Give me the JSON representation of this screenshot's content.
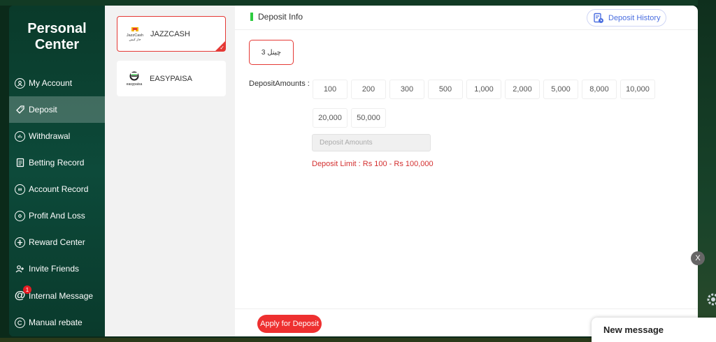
{
  "sidebar": {
    "title_line1": "Personal",
    "title_line2": "Center",
    "items": [
      {
        "label": "My Account"
      },
      {
        "label": "Deposit"
      },
      {
        "label": "Withdrawal"
      },
      {
        "label": "Betting Record"
      },
      {
        "label": "Account Record"
      },
      {
        "label": "Profit And Loss"
      },
      {
        "label": "Reward Center"
      },
      {
        "label": "Invite Friends"
      },
      {
        "label": "Internal Message",
        "badge": "1"
      },
      {
        "label": "Manual rebate"
      }
    ],
    "active_item": "Deposit"
  },
  "channels": [
    {
      "name": "JAZZCASH",
      "logo_text": "JazzCash",
      "logo_subtext": "جاز کیش",
      "selected": true
    },
    {
      "name": "EASYPAISA",
      "logo_text": "easypaisa",
      "selected": false
    }
  ],
  "deposit": {
    "header_title": "Deposit Info",
    "history_label": "Deposit History",
    "option_label": "چینل 3",
    "amounts_label": "DepositAmounts :",
    "amounts": [
      "100",
      "200",
      "300",
      "500",
      "1,000",
      "2,000",
      "5,000",
      "8,000",
      "10,000",
      "20,000",
      "50,000"
    ],
    "input_placeholder": "Deposit Amounts",
    "limit_text": "Deposit Limit :  Rs  100  -  Rs  100,000",
    "apply_label": "Apply for Deposit"
  },
  "overlay": {
    "close_label": "X",
    "popup_title": "New message"
  },
  "colors": {
    "accent_red": "#ee3030",
    "sidebar_green": "#0d4a3a",
    "header_accent": "#2ecc40",
    "link_blue": "#4a6ee0"
  }
}
